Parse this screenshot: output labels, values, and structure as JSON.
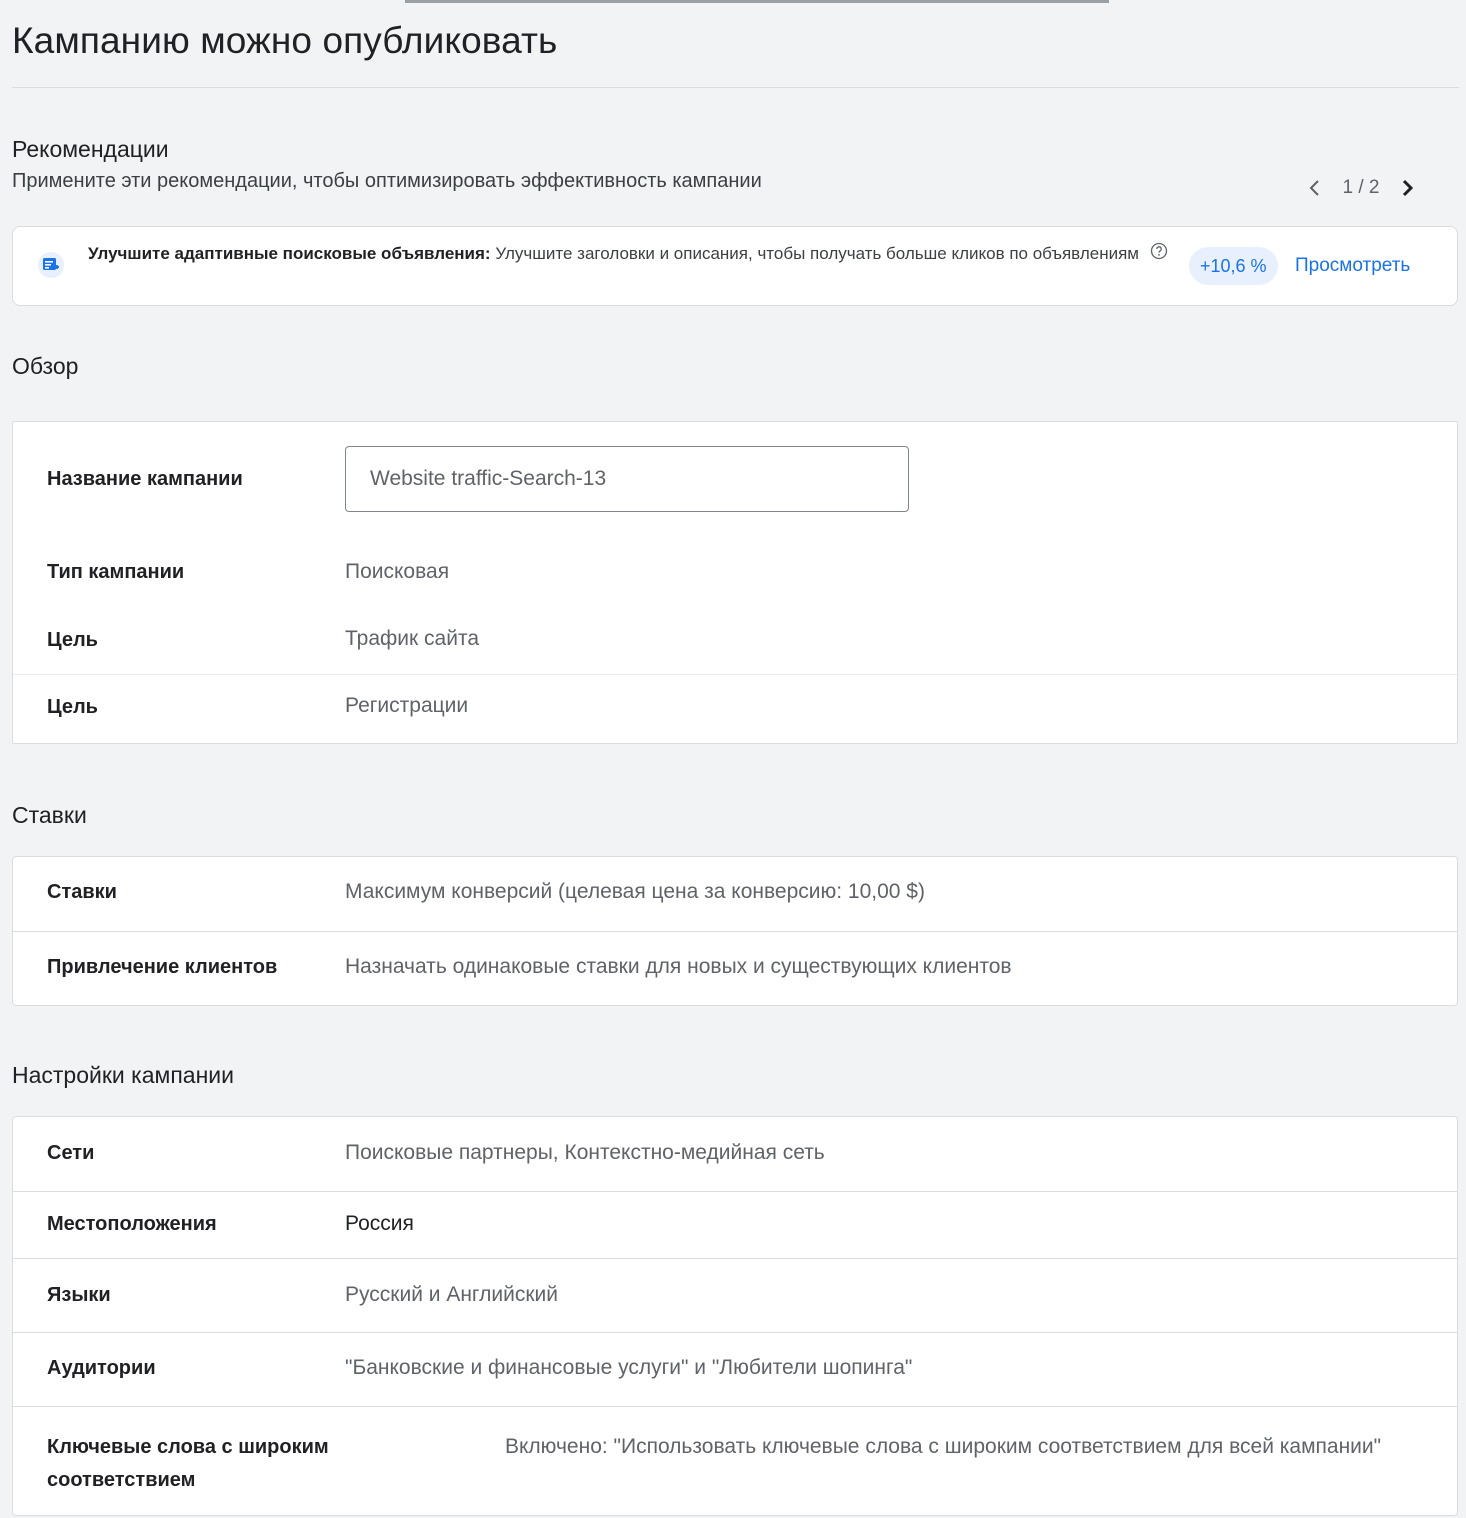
{
  "header": {
    "title": "Кампанию можно опубликовать"
  },
  "recommendations": {
    "heading": "Рекомендации",
    "subtitle": "Примените эти рекомендации, чтобы оптимизировать эффективность кампании",
    "pager": {
      "current": "1 / 2",
      "prev_icon": "chevron-left-icon",
      "next_icon": "chevron-right-icon"
    },
    "item": {
      "icon": "ad-edit-icon",
      "title": "Улучшите адаптивные поисковые объявления:",
      "description": "Улучшите заголовки и описания, чтобы получать больше кликов по объявлениям",
      "lift": "+10,6 %",
      "action": "Просмотреть"
    }
  },
  "overview": {
    "heading": "Обзор",
    "campaign_name_label": "Название кампании",
    "campaign_name_value": "Website traffic-Search-13",
    "rows": [
      {
        "label": "Тип кампании",
        "value": "Поисковая"
      },
      {
        "label": "Цель",
        "value": "Трафик сайта"
      },
      {
        "label": "Цель",
        "value": "Регистрации"
      }
    ]
  },
  "bidding": {
    "heading": "Ставки",
    "rows": [
      {
        "label": "Ставки",
        "value": "Максимум конверсий (целевая цена за конверсию: 10,00 $)"
      },
      {
        "label": "Привлечение клиентов",
        "value": "Назначать одинаковые ставки для новых и существующих клиентов"
      }
    ]
  },
  "settings": {
    "heading": "Настройки кампании",
    "rows": [
      {
        "label": "Сети",
        "value": "Поисковые партнеры, Контекстно-медийная сеть"
      },
      {
        "label": "Местоположения",
        "value": "Россия"
      },
      {
        "label": "Языки",
        "value": "Русский и Английский"
      },
      {
        "label": "Аудитории",
        "value": "\"Банковские и финансовые услуги\" и \"Любители шопинга\""
      },
      {
        "label": "Ключевые слова с широким соответствием",
        "value": "Включено: \"Использовать ключевые слова с широким соответствием для всей кампании\""
      }
    ]
  },
  "colors": {
    "page_background": "#f1f3f4",
    "card_background": "#ffffff",
    "accent_blue": "#1a73e8",
    "badge_background": "#e8f0fe",
    "border": "#dadce0"
  }
}
